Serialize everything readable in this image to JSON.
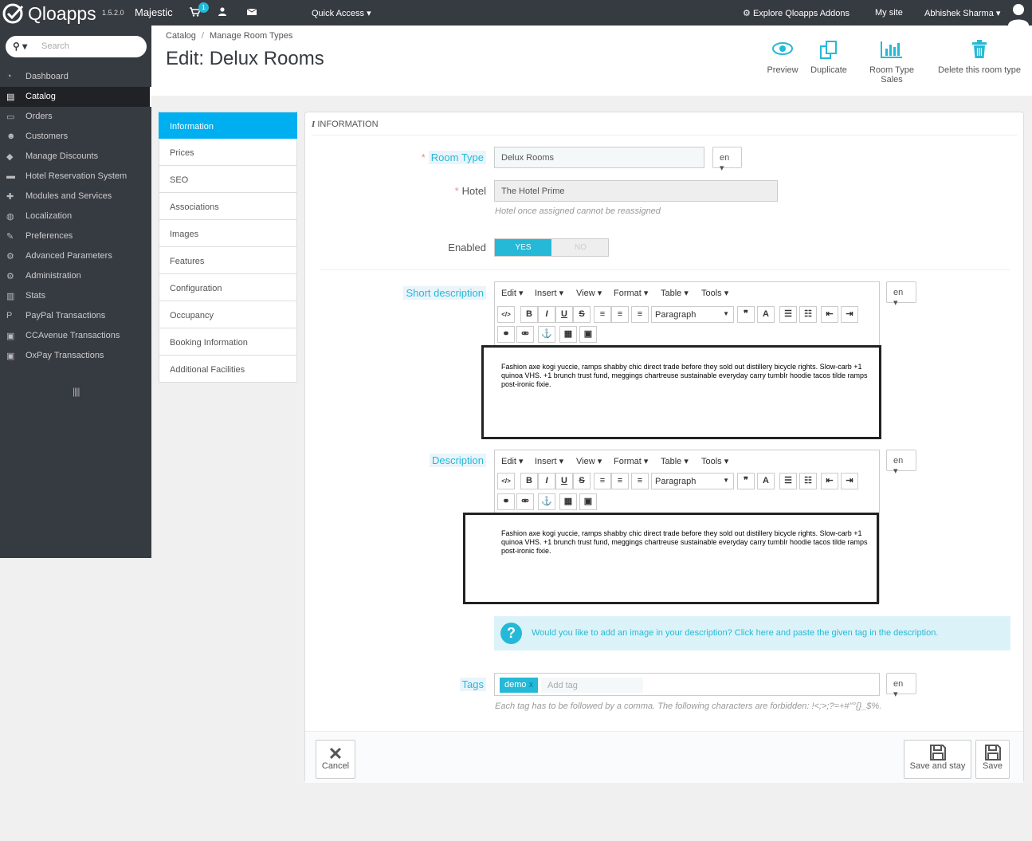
{
  "topbar": {
    "app_name": "Qloapps",
    "version": "1.5.2.0",
    "shop_name": "Majestic",
    "cart_badge": "1",
    "quick_access": "Quick Access",
    "explore": "Explore Qloapps Addons",
    "my_site": "My site",
    "user_name": "Abhishek Sharma"
  },
  "sidebar": {
    "search_placeholder": "Search",
    "items": [
      {
        "label": "Dashboard",
        "icon": "dashboard-icon"
      },
      {
        "label": "Catalog",
        "icon": "catalog-icon"
      },
      {
        "label": "Orders",
        "icon": "orders-icon"
      },
      {
        "label": "Customers",
        "icon": "customers-icon"
      },
      {
        "label": "Manage Discounts",
        "icon": "discount-icon"
      },
      {
        "label": "Hotel Reservation System",
        "icon": "bed-icon"
      },
      {
        "label": "Modules and Services",
        "icon": "puzzle-icon"
      },
      {
        "label": "Localization",
        "icon": "globe-icon"
      },
      {
        "label": "Preferences",
        "icon": "wrench-icon"
      },
      {
        "label": "Advanced Parameters",
        "icon": "cogs-icon"
      },
      {
        "label": "Administration",
        "icon": "cog-icon"
      },
      {
        "label": "Stats",
        "icon": "bar-chart-icon"
      },
      {
        "label": "PayPal Transactions",
        "icon": "paypal-icon"
      },
      {
        "label": "CCAvenue Transactions",
        "icon": "money-icon"
      },
      {
        "label": "OxPay Transactions",
        "icon": "money-icon"
      }
    ],
    "active": "Catalog"
  },
  "header": {
    "breadcrumb": [
      "Catalog",
      "Manage Room Types"
    ],
    "title": "Edit: Delux Rooms",
    "toolbar": [
      "Preview",
      "Duplicate",
      "Room Type Sales",
      "Delete this room type"
    ]
  },
  "tabs": [
    "Information",
    "Prices",
    "SEO",
    "Associations",
    "Images",
    "Features",
    "Configuration",
    "Occupancy",
    "Booking Information",
    "Additional Facilities"
  ],
  "form": {
    "panel_title": "Information",
    "room_type_label": "Room Type",
    "room_type_value": "Delux Rooms",
    "lang": "en",
    "hotel_label": "Hotel",
    "hotel_value": "The Hotel Prime",
    "hotel_hint": "Hotel once assigned cannot be reassigned",
    "enabled_label": "Enabled",
    "yes": "YES",
    "no": "NO",
    "short_desc_label": "Short description",
    "desc_label": "Description",
    "editor_menu": [
      "Edit",
      "Insert",
      "View",
      "Format",
      "Table",
      "Tools"
    ],
    "paragraph": "Paragraph",
    "desc_text": "Fashion axe kogi yuccie, ramps shabby chic direct trade before they sold out distillery bicycle rights. Slow-carb +1 quinoa VHS. +1 brunch trust fund, meggings chartreuse sustainable everyday carry tumblr hoodie tacos tilde ramps post-ironic fixie.",
    "info_text": "Would you like to add an image in your description?",
    "info_link": "Click here",
    "info_text_end": "and paste the given tag in the description.",
    "tags_label": "Tags",
    "tag_value": "demo",
    "tag_placeholder": "Add tag",
    "tags_hint": "Each tag has to be followed by a comma. The following characters are forbidden: !<;>;?=+#\"°{}_$%.",
    "cancel": "Cancel",
    "save_stay": "Save and stay",
    "save": "Save"
  },
  "colors": {
    "accent": "#25b9d7",
    "sidebar": "#363a41",
    "tab_active": "#00aff0"
  }
}
